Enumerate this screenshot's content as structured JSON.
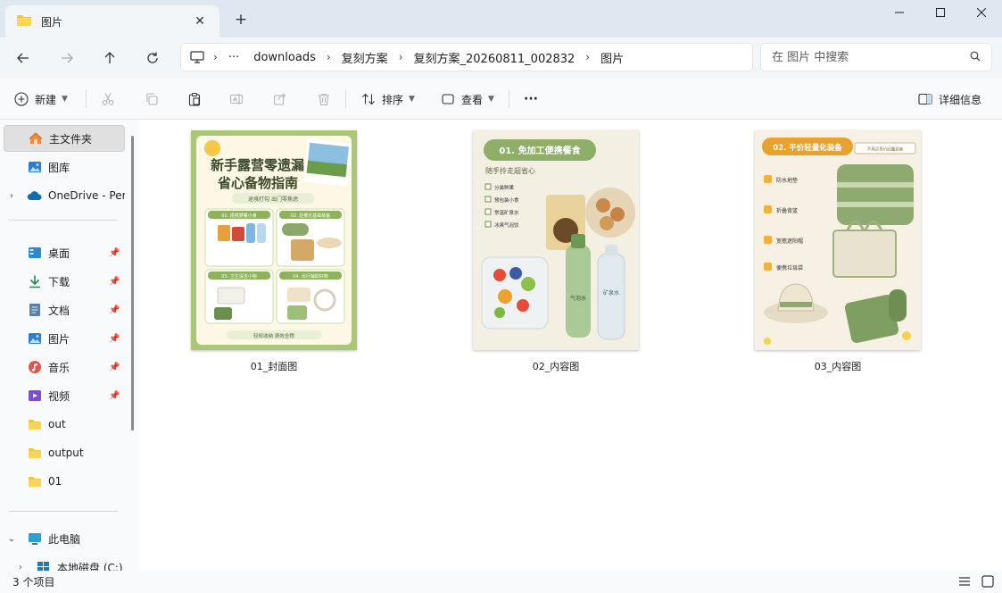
{
  "window": {
    "tab_title": "图片",
    "tab_close": "✕",
    "new_tab": "+"
  },
  "addressbar": {
    "more": "···",
    "crumbs": [
      "downloads",
      "复刻方案",
      "复刻方案_20260811_002832",
      "图片"
    ],
    "search_placeholder": "在 图片 中搜索"
  },
  "commandbar": {
    "new_label": "新建",
    "sort_label": "排序",
    "view_label": "查看",
    "more_label": "···",
    "details_label": "详细信息"
  },
  "sidebar": {
    "home": "主文件夹",
    "gallery": "图库",
    "onedrive": "OneDrive - Per",
    "quick_access": [
      "桌面",
      "下载",
      "文档",
      "图片",
      "音乐",
      "视频",
      "out",
      "output",
      "01"
    ],
    "this_pc": "此电脑",
    "local_disk": "本地磁盘 (C:)"
  },
  "files": [
    {
      "name": "01_封面图",
      "title_line1": "新手露营零遗漏",
      "title_line2": "省心备物指南",
      "subtitle": "途境打勾 出门零焦虑",
      "sections": [
        "01. 便携野餐小食",
        "02. 轻量化基础装备",
        "03. 卫生清洁小物",
        "04. 出行辅助好物"
      ],
      "footer": "轻松收纳 费效全程"
    },
    {
      "name": "02_内容图",
      "header": "01. 免加工便携餐食",
      "tagline": "随手拎走超省心",
      "items": [
        "分装鲜果",
        "预包装小食",
        "常温矿泉水",
        "冰爽气泡饮"
      ],
      "bottle_label_1": "气泡水",
      "bottle_label_2": "矿泉水"
    },
    {
      "name": "03_内容图",
      "header": "02. 平价轻量化装备",
      "badge": "不用买贵价团露装备",
      "items": [
        "防水地垫",
        "折叠背篮",
        "宽檐遮阳帽",
        "便携垃圾袋"
      ]
    }
  ],
  "status": {
    "count": "3 个项目"
  },
  "colors": {
    "titlebar": "#dfe8f1",
    "accent_blue": "#0067c0",
    "folder_yellow": "#f5c242",
    "thumb_green": "#93b56b",
    "thumb_orange": "#e8a32f"
  }
}
